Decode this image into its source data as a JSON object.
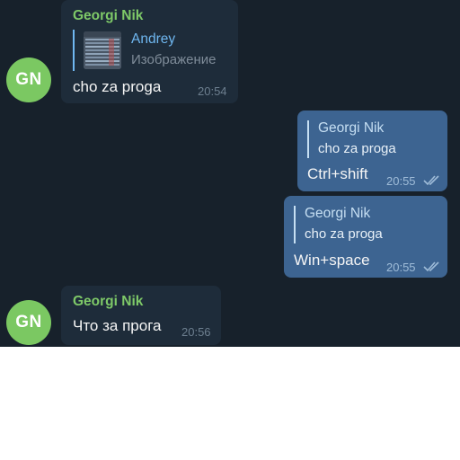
{
  "colors": {
    "chat_background": "#17212b",
    "incoming_bubble": "#1e2c3a",
    "outgoing_bubble": "#3d6491",
    "avatar_green": "#7bc862",
    "sender_green": "#7ec968",
    "reply_blue": "#6fb7f0",
    "outgoing_meta": "#9fbcd8",
    "incoming_meta": "#6d7f8f"
  },
  "messages": [
    {
      "direction": "incoming",
      "avatar_initials": "GN",
      "sender": "Georgi Nik",
      "reply": {
        "name": "Andrey",
        "text": "Изображение",
        "has_thumbnail": true
      },
      "text": "cho za proga",
      "time": "20:54"
    },
    {
      "direction": "outgoing",
      "reply": {
        "name": "Georgi Nik",
        "text": "cho za proga"
      },
      "text": "Ctrl+shift",
      "time": "20:55",
      "status_icon": "double-check-icon"
    },
    {
      "direction": "outgoing",
      "reply": {
        "name": "Georgi Nik",
        "text": "cho za proga"
      },
      "text": "Win+space",
      "time": "20:55",
      "status_icon": "double-check-icon"
    },
    {
      "direction": "incoming",
      "avatar_initials": "GN",
      "sender": "Georgi Nik",
      "text": "Что за прога",
      "time": "20:56"
    }
  ]
}
